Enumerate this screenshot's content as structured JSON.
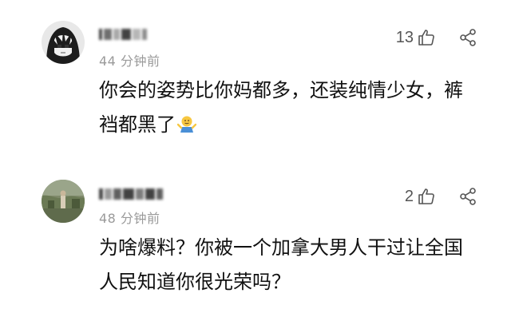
{
  "comments": [
    {
      "time": "44 分钟前",
      "likes": "13",
      "text": "你会的姿势比你妈都多，还装纯情少女，裤裆都黑了",
      "emoji": "shrug-emoji",
      "avatar": "anime-avatar"
    },
    {
      "time": "48 分钟前",
      "likes": "2",
      "text": "为啥爆料？你被一个加拿大男人干过让全国人民知道你很光荣吗？",
      "avatar": "photo-avatar"
    }
  ],
  "colors": {
    "text": "#111111",
    "muted": "#9a9a9a",
    "icon": "#555555"
  },
  "icons": [
    "thumb-up-icon",
    "share-icon"
  ]
}
